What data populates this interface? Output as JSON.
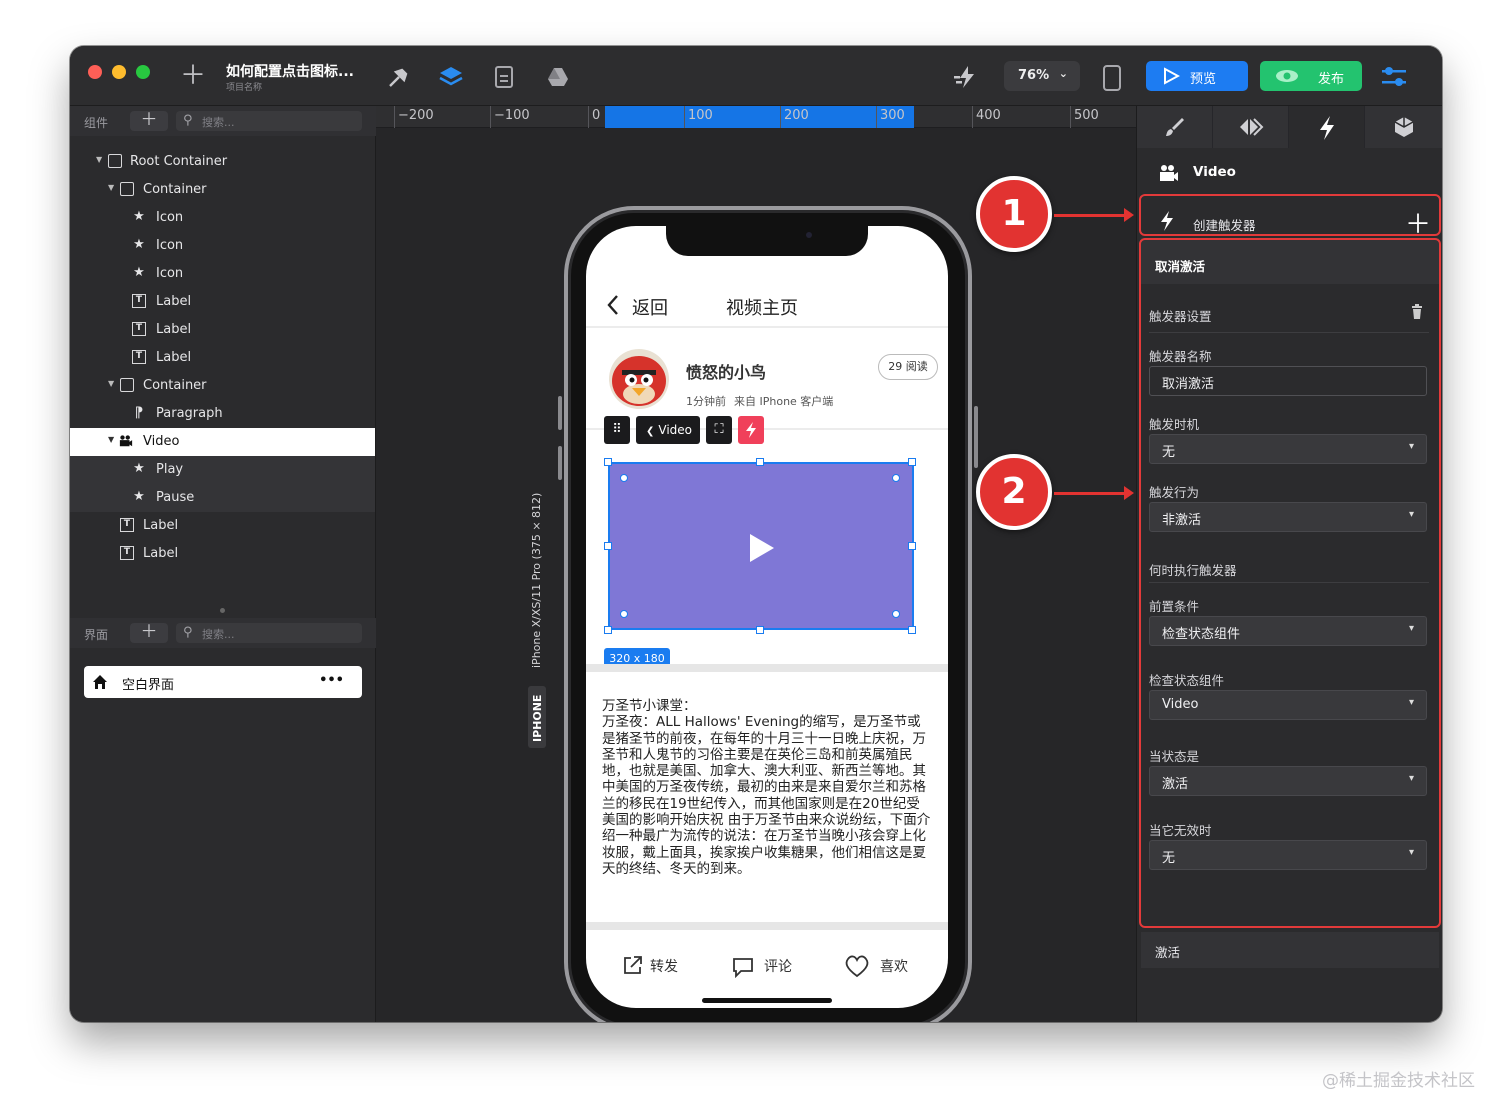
{
  "titlebar": {
    "project_title": "如何配置点击图标...",
    "project_subtitle": "项目名称",
    "zoom": "76%",
    "preview_label": "预览",
    "publish_label": "发布"
  },
  "components_panel": {
    "label": "组件",
    "search_placeholder": "搜索...",
    "tree": [
      {
        "label": "Root Container",
        "icon": "square-icon"
      },
      {
        "label": "Container",
        "icon": "square-icon"
      },
      {
        "label": "Icon",
        "icon": "star-icon"
      },
      {
        "label": "Icon",
        "icon": "star-icon"
      },
      {
        "label": "Icon",
        "icon": "star-icon"
      },
      {
        "label": "Label",
        "icon": "text-box-icon"
      },
      {
        "label": "Label",
        "icon": "text-box-icon"
      },
      {
        "label": "Label",
        "icon": "text-box-icon"
      },
      {
        "label": "Container",
        "icon": "square-icon"
      },
      {
        "label": "Paragraph",
        "icon": "paragraph-icon"
      },
      {
        "label": "Video",
        "icon": "video-camera-icon"
      },
      {
        "label": "Play",
        "icon": "star-icon"
      },
      {
        "label": "Pause",
        "icon": "star-icon"
      },
      {
        "label": "Label",
        "icon": "text-box-icon"
      },
      {
        "label": "Label",
        "icon": "text-box-icon"
      }
    ]
  },
  "pages_panel": {
    "label": "界面",
    "search_placeholder": "搜索...",
    "page_name": "空白界面",
    "more": "•••"
  },
  "ruler": {
    "labels": [
      "−200",
      "−100",
      "0",
      "100",
      "200",
      "300",
      "400",
      "500"
    ]
  },
  "device": {
    "side_label": "iPhone X/XS/11 Pro (375 × 812)",
    "badge": "IPHONE"
  },
  "phone": {
    "back_label": "返回",
    "page_title": "视频主页",
    "author": "愤怒的小鸟",
    "reads": "29 阅读",
    "meta_time": "1分钟前",
    "meta_source": "来自 IPhone 客户端",
    "toolbar_video": "Video",
    "size_badge": "320 x 180",
    "article": "万圣节小课堂：\n万圣夜：ALL Hallows' Evening的缩写，是万圣节或是猪圣节的前夜，在每年的十月三十一日晚上庆祝，万圣节和人鬼节的习俗主要是在英伦三岛和前英属殖民地，也就是美国、加拿大、澳大利亚、新西兰等地。其中美国的万圣夜传统，最初的由来是来自爱尔兰和苏格兰的移民在19世纪传入，而其他国家则是在20世纪受美国的影响开始庆祝 由于万圣节由来众说纷纭，下面介绍一种最广为流传的说法：在万圣节当晚小孩会穿上化妆服，戴上面具，挨家挨户收集糖果，他们相信这是夏天的终结、冬天的到来。",
    "share": "转发",
    "comment": "评论",
    "like": "喜欢"
  },
  "inspector": {
    "component_name": "Video",
    "create_trigger": "创建触发器",
    "trigger_deactivate": "取消激活",
    "trigger_settings": "触发器设置",
    "trigger_name_label": "触发器名称",
    "trigger_name_value": "取消激活",
    "trigger_time_label": "触发时机",
    "trigger_time_value": "无",
    "trigger_action_label": "触发行为",
    "trigger_action_value": "非激活",
    "when_label": "何时执行触发器",
    "precondition_label": "前置条件",
    "precondition_value": "检查状态组件",
    "check_component_label": "检查状态组件",
    "check_component_value": "Video",
    "state_label": "当状态是",
    "state_value": "激活",
    "invalid_label": "当它无效时",
    "invalid_value": "无",
    "trigger_activate": "激活"
  },
  "markers": {
    "m1": "1",
    "m2": "2"
  },
  "watermark": "@稀土掘金技术社区",
  "colors": {
    "accent": "#1d7cf2",
    "publish": "#23c36f",
    "annotation_red": "#e23331",
    "video_fill": "#7f77d6",
    "trigger_pink": "#f0405a"
  }
}
